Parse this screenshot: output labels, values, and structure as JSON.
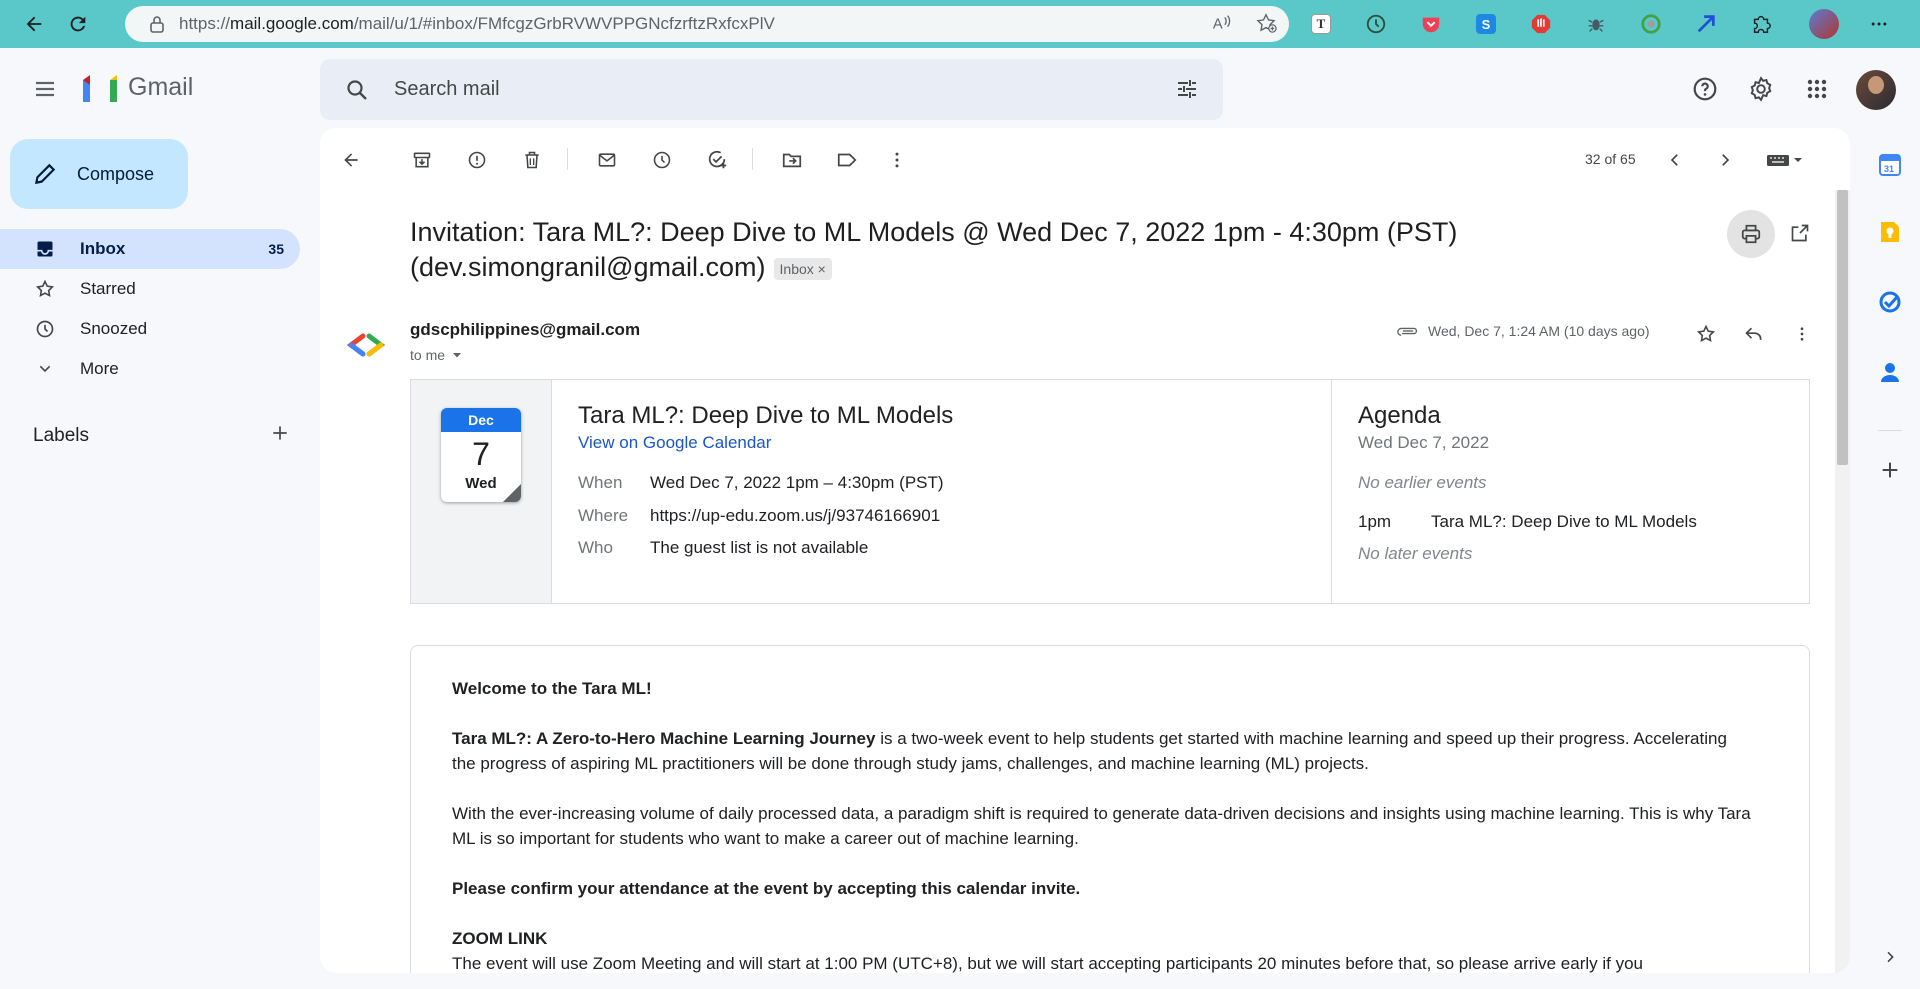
{
  "browser": {
    "url_prefix": "https://",
    "url_host": "mail.google.com",
    "url_path": "/mail/u/1/#inbox/FMfcgzGrbRVWVPPGNcfzrftzRxfcxPlV",
    "extensions": [
      "text-extension-icon",
      "clock-extension-icon",
      "pocket-icon",
      "skype-icon",
      "adblock-icon",
      "bug-icon",
      "chrome-extension-icon",
      "arrow-extension-icon",
      "puzzle-icon"
    ]
  },
  "gmail": {
    "logo_text": "Gmail",
    "search_placeholder": "Search mail"
  },
  "compose": {
    "label": "Compose"
  },
  "nav": {
    "items": [
      {
        "label": "Inbox",
        "count": "35",
        "icon": "inbox-icon"
      },
      {
        "label": "Starred",
        "count": "",
        "icon": "star-icon"
      },
      {
        "label": "Snoozed",
        "count": "",
        "icon": "clock-icon"
      },
      {
        "label": "More",
        "count": "",
        "icon": "chevron-down-icon"
      }
    ],
    "labels_heading": "Labels"
  },
  "toolbar": {
    "pager": "32 of 65"
  },
  "email": {
    "subject": "Invitation: Tara ML?: Deep Dive to ML Models @ Wed Dec 7, 2022 1pm - 4:30pm (PST) (dev.simongranil@gmail.com)",
    "label_chip": "Inbox",
    "chip_close": "×",
    "sender": "gdscphilippines@gmail.com",
    "to": "to me",
    "date": "Wed, Dec 7, 1:24 AM (10 days ago)"
  },
  "calendar": {
    "month": "Dec",
    "day": "7",
    "weekday": "Wed",
    "event_title": "Tara ML?: Deep Dive to ML Models",
    "view_link": "View on Google Calendar",
    "when_label": "When",
    "when_value": "Wed Dec 7, 2022 1pm – 4:30pm (PST)",
    "where_label": "Where",
    "where_value": "https://up-edu.zoom.us/j/93746166901",
    "who_label": "Who",
    "who_value": "The guest list is not available",
    "agenda_title": "Agenda",
    "agenda_date": "Wed Dec 7, 2022",
    "no_earlier": "No earlier events",
    "agenda_time": "1pm",
    "agenda_event": "Tara ML?: Deep Dive to ML Models",
    "no_later": "No later events"
  },
  "body": {
    "welcome": "Welcome to the Tara ML!",
    "p1_bold": "Tara ML?: A Zero-to-Hero Machine Learning Journey",
    "p1_rest": " is a two-week event to help students get started with machine learning and speed up their progress. Accelerating the progress of aspiring ML practitioners will be done through study jams, challenges, and machine learning (ML) projects.",
    "p2": "With the ever-increasing volume of daily processed data, a paradigm shift is required to generate data-driven decisions and insights using machine learning. This is why Tara ML is so important for students who want to make a career out of machine learning.",
    "confirm": "Please confirm your attendance at the event by accepting this calendar invite.",
    "zoom_heading": "ZOOM LINK",
    "zoom_text": "The event will use Zoom Meeting and will start at 1:00 PM (UTC+8), but we will start accepting participants 20 minutes before that, so please arrive early if you"
  }
}
